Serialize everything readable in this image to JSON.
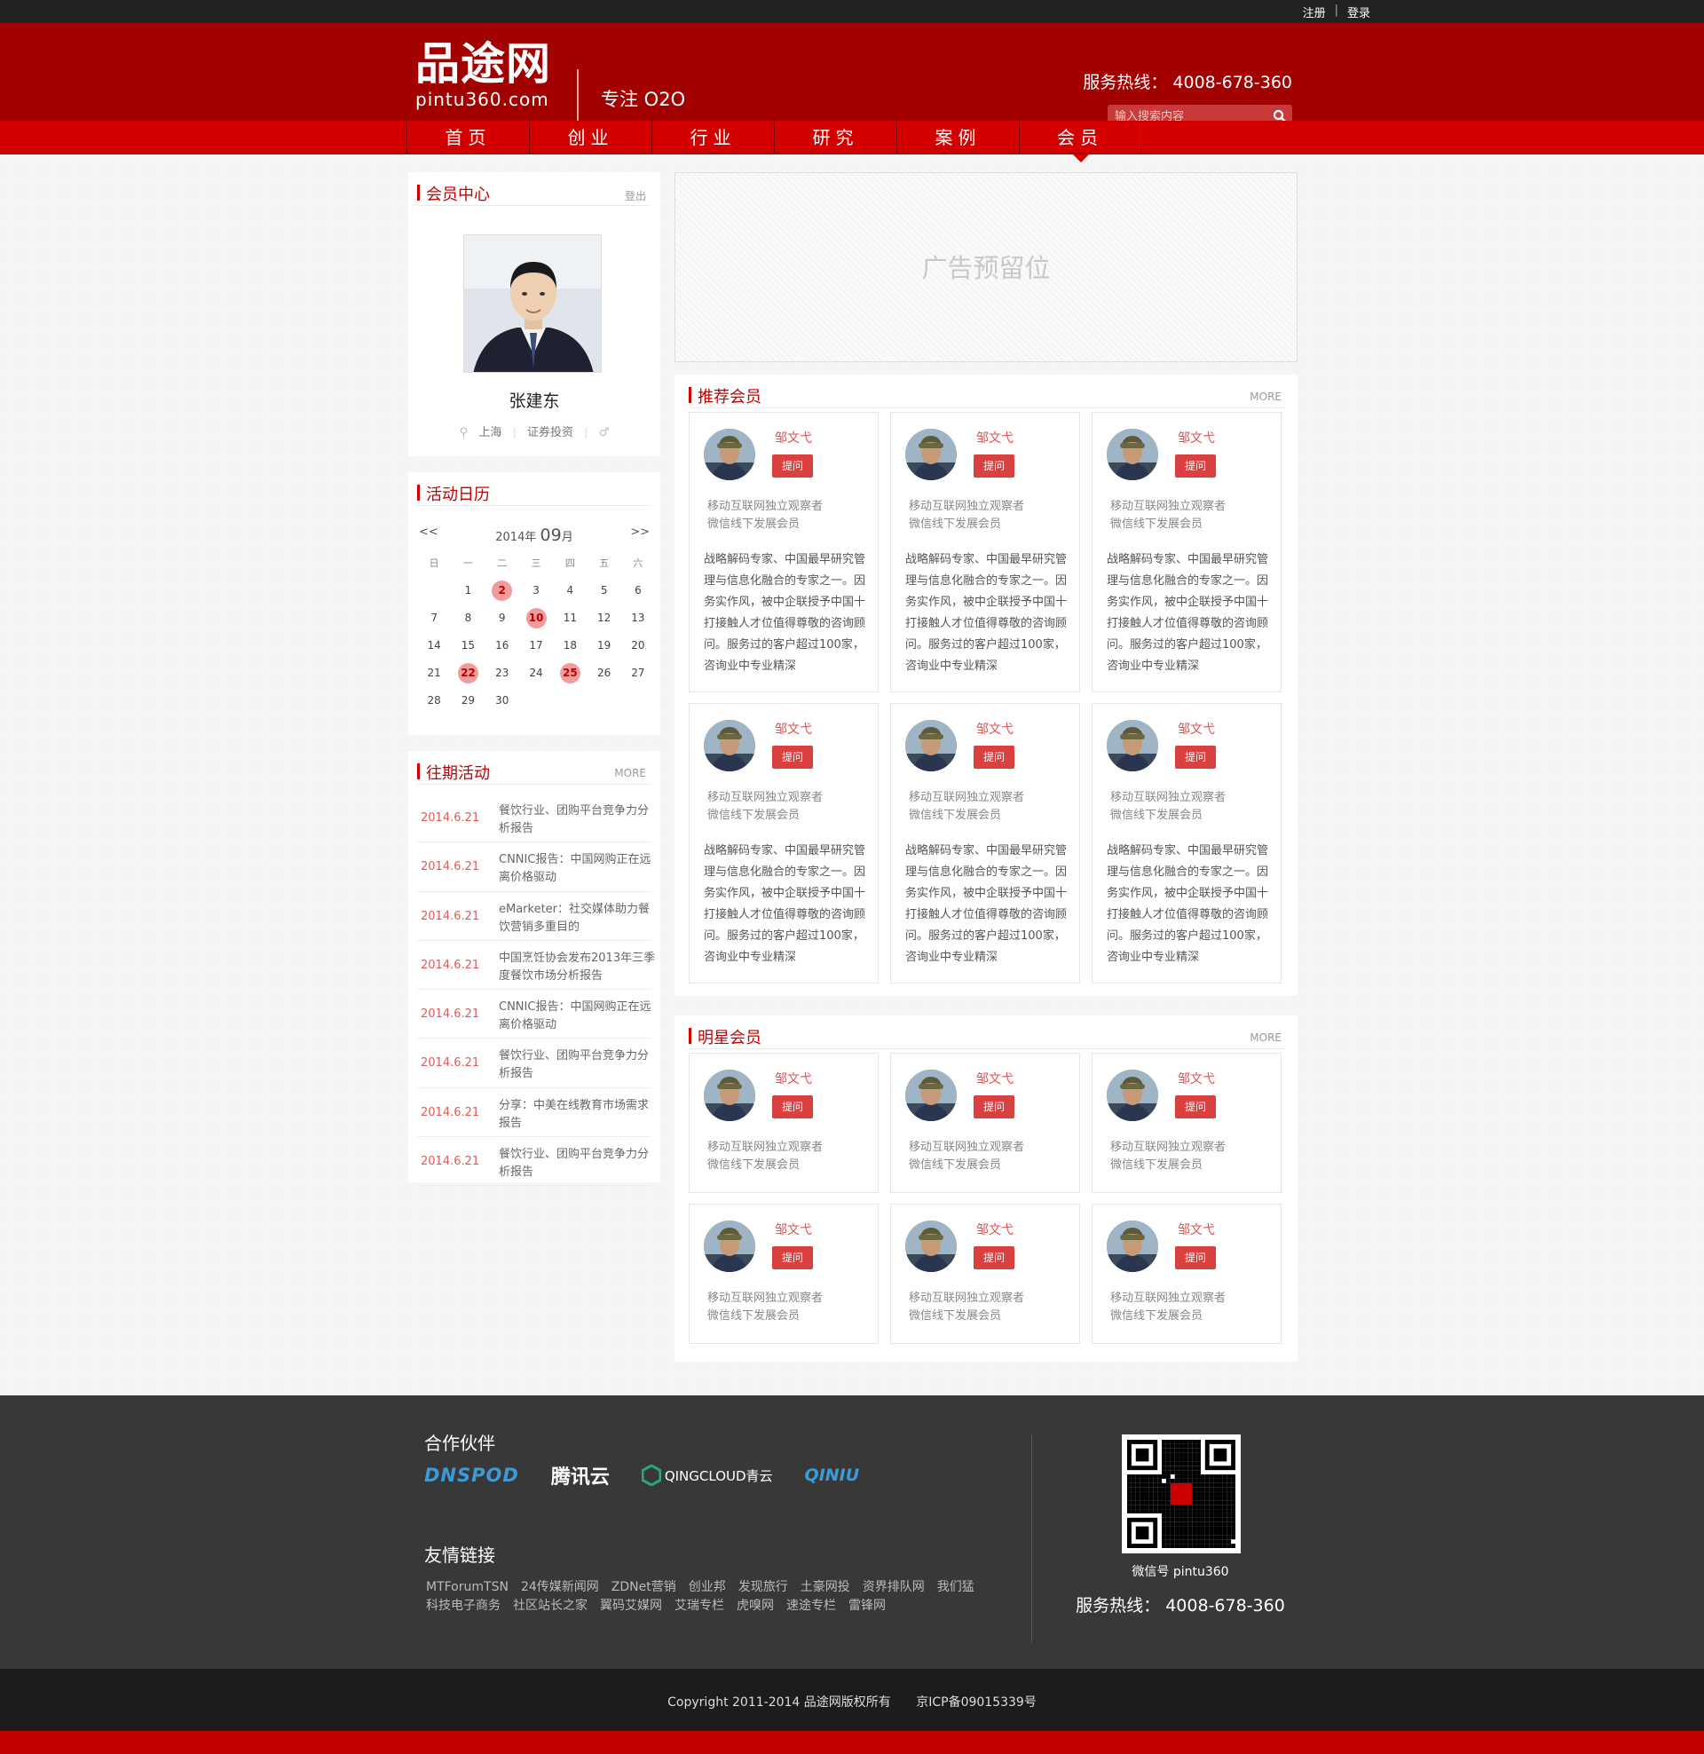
{
  "topbar": {
    "register": "注册",
    "sep": "|",
    "login": "登录"
  },
  "header": {
    "logo_cn": "品途网",
    "logo_en": "pintu360.com",
    "slogan": "专注 O2O",
    "hotline": "服务热线： 4008-678-360",
    "search_placeholder": "输入搜索内容"
  },
  "nav": {
    "items": [
      {
        "label": "首页"
      },
      {
        "label": "创业"
      },
      {
        "label": "行业"
      },
      {
        "label": "研究"
      },
      {
        "label": "案例"
      },
      {
        "label": "会员"
      }
    ],
    "active": "会员"
  },
  "member": {
    "title": "会员中心",
    "logout": "登出",
    "name": "张建东",
    "city": "上海",
    "industry": "证券投资",
    "gender_icon": "male-icon"
  },
  "calendar": {
    "title": "活动日历",
    "prev": "<<",
    "next": ">>",
    "year": "2014",
    "year_suffix": "年",
    "month": "09",
    "month_suffix": "月",
    "weekdays": [
      "日",
      "一",
      "二",
      "三",
      "四",
      "五",
      "六"
    ],
    "leading_blanks": 1,
    "days_in_month": 30,
    "highlight_days": [
      2,
      10,
      22,
      25
    ]
  },
  "past": {
    "title": "往期活动",
    "more": "MORE",
    "items": [
      {
        "date": "2014.6.21",
        "text": "餐饮行业、团购平台竞争力分析报告"
      },
      {
        "date": "2014.6.21",
        "text": "CNNIC报告：中国网购正在远离价格驱动"
      },
      {
        "date": "2014.6.21",
        "text": "eMarketer：社交媒体助力餐饮营销多重目的"
      },
      {
        "date": "2014.6.21",
        "text": "中国烹饪协会发布2013年三季度餐饮市场分析报告"
      },
      {
        "date": "2014.6.21",
        "text": "CNNIC报告：中国网购正在远离价格驱动"
      },
      {
        "date": "2014.6.21",
        "text": "餐饮行业、团购平台竞争力分析报告"
      },
      {
        "date": "2014.6.21",
        "text": "分享：中美在线教育市场需求报告"
      },
      {
        "date": "2014.6.21",
        "text": "餐饮行业、团购平台竞争力分析报告"
      }
    ]
  },
  "ad": {
    "text": "广告预留位"
  },
  "recommended": {
    "title": "推荐会员",
    "more": "MORE",
    "cards": [
      {
        "name": "邹文弋",
        "ask": "提问",
        "desc1": "移动互联网独立观察者",
        "desc2": "微信线下发展会员",
        "bio": "战略解码专家、中国最早研究管理与信息化融合的专家之一。因务实作风，被中企联授予中国十打接触人才位值得尊敬的咨询顾问。服务过的客户超过100家，咨询业中专业精深"
      },
      {
        "name": "邹文弋",
        "ask": "提问",
        "desc1": "移动互联网独立观察者",
        "desc2": "微信线下发展会员",
        "bio": "战略解码专家、中国最早研究管理与信息化融合的专家之一。因务实作风，被中企联授予中国十打接触人才位值得尊敬的咨询顾问。服务过的客户超过100家，咨询业中专业精深"
      },
      {
        "name": "邹文弋",
        "ask": "提问",
        "desc1": "移动互联网独立观察者",
        "desc2": "微信线下发展会员",
        "bio": "战略解码专家、中国最早研究管理与信息化融合的专家之一。因务实作风，被中企联授予中国十打接触人才位值得尊敬的咨询顾问。服务过的客户超过100家，咨询业中专业精深"
      },
      {
        "name": "邹文弋",
        "ask": "提问",
        "desc1": "移动互联网独立观察者",
        "desc2": "微信线下发展会员",
        "bio": "战略解码专家、中国最早研究管理与信息化融合的专家之一。因务实作风，被中企联授予中国十打接触人才位值得尊敬的咨询顾问。服务过的客户超过100家，咨询业中专业精深"
      },
      {
        "name": "邹文弋",
        "ask": "提问",
        "desc1": "移动互联网独立观察者",
        "desc2": "微信线下发展会员",
        "bio": "战略解码专家、中国最早研究管理与信息化融合的专家之一。因务实作风，被中企联授予中国十打接触人才位值得尊敬的咨询顾问。服务过的客户超过100家，咨询业中专业精深"
      },
      {
        "name": "邹文弋",
        "ask": "提问",
        "desc1": "移动互联网独立观察者",
        "desc2": "微信线下发展会员",
        "bio": "战略解码专家、中国最早研究管理与信息化融合的专家之一。因务实作风，被中企联授予中国十打接触人才位值得尊敬的咨询顾问。服务过的客户超过100家，咨询业中专业精深"
      }
    ]
  },
  "star": {
    "title": "明星会员",
    "more": "MORE",
    "cards": [
      {
        "name": "邹文弋",
        "ask": "提问",
        "desc1": "移动互联网独立观察者",
        "desc2": "微信线下发展会员"
      },
      {
        "name": "邹文弋",
        "ask": "提问",
        "desc1": "移动互联网独立观察者",
        "desc2": "微信线下发展会员"
      },
      {
        "name": "邹文弋",
        "ask": "提问",
        "desc1": "移动互联网独立观察者",
        "desc2": "微信线下发展会员"
      },
      {
        "name": "邹文弋",
        "ask": "提问",
        "desc1": "移动互联网独立观察者",
        "desc2": "微信线下发展会员"
      },
      {
        "name": "邹文弋",
        "ask": "提问",
        "desc1": "移动互联网独立观察者",
        "desc2": "微信线下发展会员"
      },
      {
        "name": "邹文弋",
        "ask": "提问",
        "desc1": "移动互联网独立观察者",
        "desc2": "微信线下发展会员"
      }
    ]
  },
  "footer": {
    "partners_title": "合作伙伴",
    "partners": [
      "DNSPOD",
      "腾讯云",
      "QINGCLOUD青云",
      "QINIU"
    ],
    "links_title": "友情链接",
    "links": [
      "MTForumTSN",
      "24传媒新闻网",
      "ZDNet营销",
      "创业邦",
      "发现旅行",
      "土豪网投",
      "资界排队网",
      "我们猛科技电子商务",
      "社区站长之家",
      "翼码艾媒网",
      "艾瑞专栏",
      "虎嗅网",
      "速途专栏",
      "雷锋网"
    ],
    "wechat": "微信号 pintu360",
    "hotline": "服务热线： 4008-678-360"
  },
  "copyright": {
    "text": "Copyright 2011-2014 品途网版权所有",
    "icp": "京ICP备09015339号"
  },
  "colors": {
    "brand_red": "#d40000",
    "dark_red": "#a30000",
    "footer": "#383838"
  }
}
